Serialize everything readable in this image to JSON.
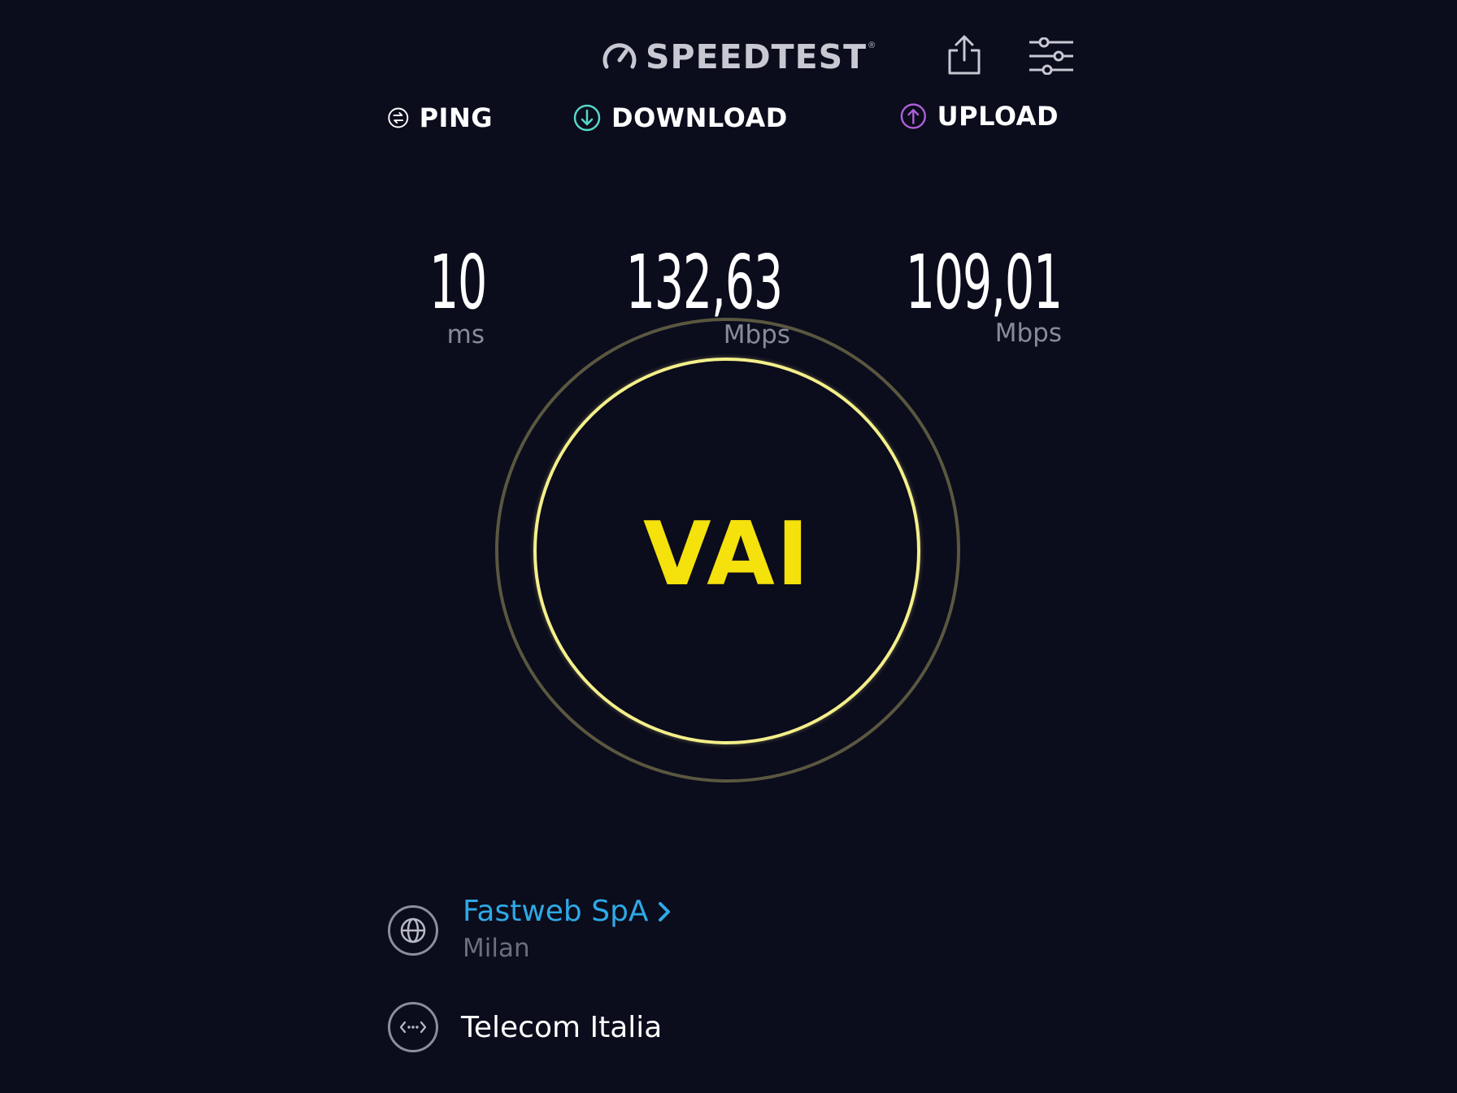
{
  "header": {
    "brand": "SPEEDTEST",
    "trademark": "®",
    "icons": [
      "speedometer-icon",
      "share-icon",
      "settings-sliders-icon"
    ]
  },
  "metrics": {
    "ping": {
      "label": "PING",
      "value": "10",
      "unit": "ms",
      "icon": "ping-icon",
      "color": "#ffffff"
    },
    "download": {
      "label": "DOWNLOAD",
      "value": "132,63",
      "unit": "Mbps",
      "icon": "download-arrow-icon",
      "color": "#57d7c8"
    },
    "upload": {
      "label": "UPLOAD",
      "value": "109,01",
      "unit": "Mbps",
      "icon": "upload-arrow-icon",
      "color": "#b05fd9"
    }
  },
  "go_button": {
    "label": "VAI",
    "color": "#f5e10c"
  },
  "server": {
    "name": "Fastweb SpA",
    "city": "Milan",
    "icon": "globe-icon"
  },
  "isp": {
    "name": "Telecom Italia",
    "icon": "connection-icon"
  },
  "colors": {
    "background": "#0b0c1c",
    "accent": "#f5e10c",
    "link": "#2ea9e6"
  }
}
